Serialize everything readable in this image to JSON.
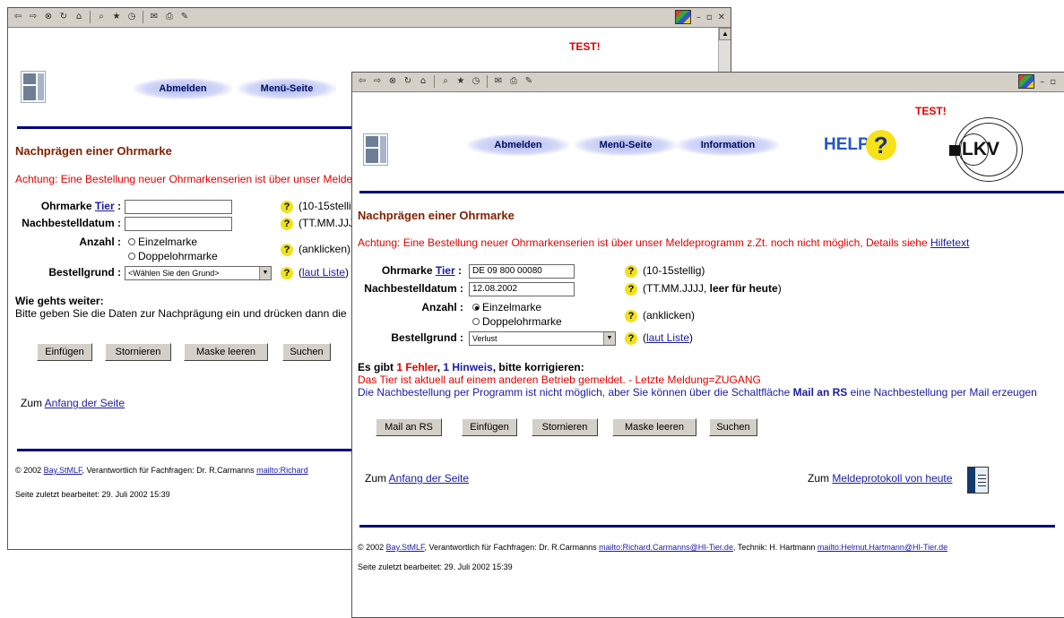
{
  "back": {
    "test": "TEST!",
    "nav": [
      "Abmelden",
      "Menü-Seite"
    ],
    "title": "Nachprägen einer Ohrmarke",
    "warning": "Achtung: Eine Bestellung neuer Ohrmarkenserien ist über unser Melde",
    "fields": {
      "ohrmarke_label": "Ohrmarke",
      "tier_link": "Tier",
      "colon": ":",
      "datum_label": "Nachbestelldatum :",
      "anzahl_label": "Anzahl :",
      "grund_label": "Bestellgrund :",
      "ohrmarke_value": "",
      "datum_value": "",
      "radio1": "Einzelmarke",
      "radio2": "Doppelohrmarke",
      "grund_value": "<Wählen Sie den Grund>"
    },
    "hints": {
      "h1": "(10-15stellig",
      "h2": "(TT.MM.JJJ",
      "h3": "(anklicken)",
      "h4_link": "laut Liste",
      "h4_open": "(",
      "h4_close": ")"
    },
    "next_title": "Wie gehts weiter:",
    "next_text": "Bitte geben Sie die Daten zur Nachprägung ein und drücken dann die",
    "buttons": [
      "Einfügen",
      "Stornieren",
      "Maske leeren",
      "Suchen"
    ],
    "zum_prefix": "Zum ",
    "zum_link": "Anfang der Seite",
    "footer_prefix": "© 2002 ",
    "footer_link1": "Bay.StMLF",
    "footer_mid": ", Verantwortlich für Fachfragen: Dr. R.Carmanns ",
    "footer_link2": "mailto:Richard",
    "edited": "Seite zuletzt bearbeitet: 29. Juli 2002 15:39"
  },
  "front": {
    "test": "TEST!",
    "nav": [
      "Abmelden",
      "Menü-Seite",
      "Information"
    ],
    "help": "HELP",
    "help_q": "?",
    "lkv": "LKV",
    "title": "Nachprägen einer Ohrmarke",
    "warning": "Achtung: Eine Bestellung neuer Ohrmarkenserien ist über unser Meldeprogramm z.Zt. noch nicht möglich, Details siehe ",
    "warning_link": "Hilfetext",
    "fields": {
      "ohrmarke_label": "Ohrmarke",
      "tier_link": "Tier",
      "colon": ":",
      "datum_label": "Nachbestelldatum :",
      "anzahl_label": "Anzahl :",
      "grund_label": "Bestellgrund :",
      "ohrmarke_value": "DE 09 800 00080",
      "datum_value": "12.08.2002",
      "radio1": "Einzelmarke",
      "radio2": "Doppelohrmarke",
      "grund_value": "Verlust"
    },
    "hints": {
      "h1": "(10-15stellig)",
      "h2_pre": "(TT.MM.JJJJ, ",
      "h2_bold": "leer für heute",
      "h2_post": ")",
      "h3": "(anklicken)",
      "h4_open": "(",
      "h4_link": "laut Liste",
      "h4_close": ")"
    },
    "errors": {
      "p1": "Es gibt ",
      "fehler": "1 Fehler",
      "p2": ", ",
      "hinweis": "1 Hinweis",
      "p3": ", bitte korrigieren:",
      "line1": "Das Tier ist aktuell auf einem anderen Betrieb gemeldet. - Letzte Meldung=ZUGANG",
      "line2_pre": "Die Nachbestellung per Programm ist nicht möglich, aber Sie können über die Schaltfläche ",
      "line2_bold": "Mail an RS",
      "line2_post": " eine Nachbestellung per Mail erzeugen"
    },
    "buttons": [
      "Mail an RS",
      "Einfügen",
      "Stornieren",
      "Maske leeren",
      "Suchen"
    ],
    "zum_prefix": "Zum ",
    "zum_link": "Anfang der Seite",
    "proto_prefix": "Zum ",
    "proto_link": "Meldeprotokoll von heute",
    "footer_prefix": "© 2002 ",
    "footer_link1": "Bay.StMLF",
    "footer_mid": ", Verantwortlich für Fachfragen: Dr. R.Carmanns ",
    "footer_link2": "mailto:Richard.Carmanns@HI-Tier.de",
    "footer_mid2": ", Technik: H. Hartmann ",
    "footer_link3": "mailto:Helmut.Hartmann@HI-Tier.de",
    "edited": "Seite zuletzt bearbeitet: 29. Juli 2002 15:39"
  },
  "toolbar_icons": [
    "back-icon",
    "forward-icon",
    "stop-icon",
    "refresh-icon",
    "home-icon",
    "search-icon",
    "favorites-icon",
    "history-icon",
    "mail-icon",
    "print-icon",
    "edit-icon"
  ],
  "colors": {
    "nav_blue": "#000080",
    "title_brown": "#802000",
    "error_red": "#e00000",
    "link_blue": "#1a1aa0",
    "help_yellow": "#f5e21a"
  }
}
